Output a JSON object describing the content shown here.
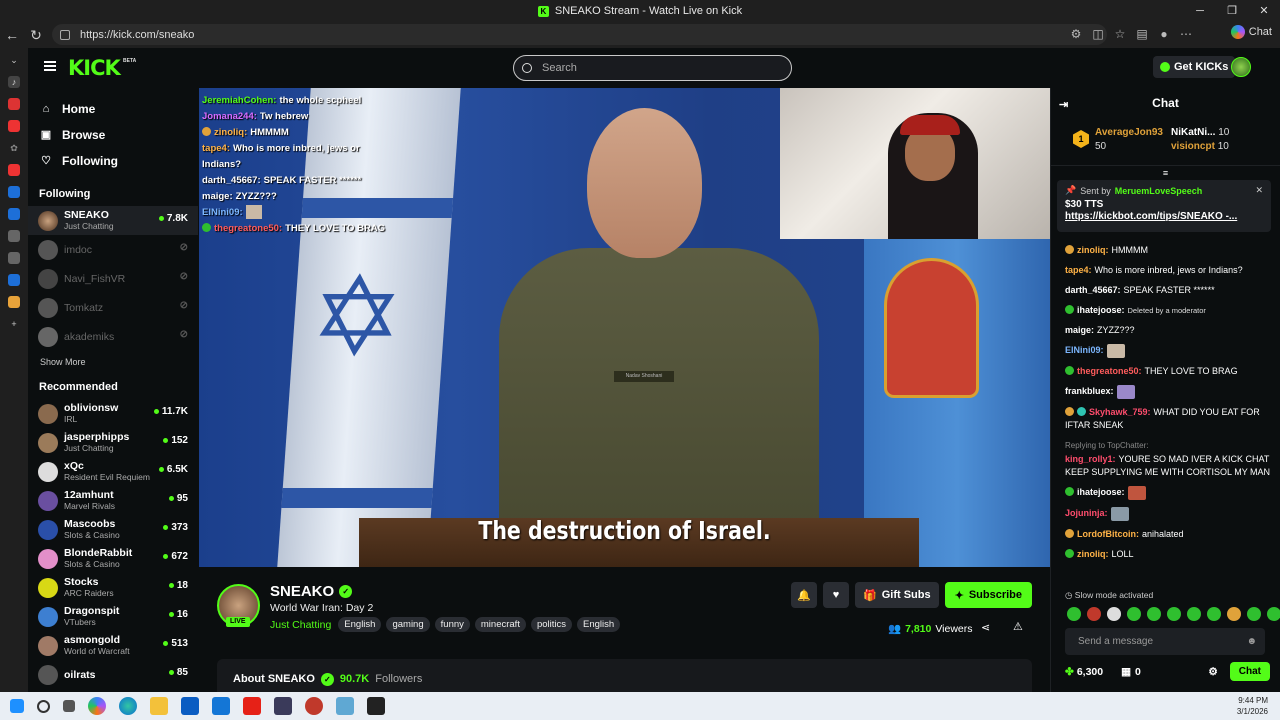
{
  "window": {
    "title": "SNEAKO Stream - Watch Live on Kick",
    "url": "https://kick.com/sneako"
  },
  "browser": {
    "copilot_label": "Chat"
  },
  "header": {
    "logo": "KICK",
    "beta": "BETA",
    "search_placeholder": "Search",
    "get_kicks": "Get KICKs"
  },
  "sidebar": {
    "nav": [
      {
        "label": "Home",
        "icon": "home-icon"
      },
      {
        "label": "Browse",
        "icon": "browse-icon"
      },
      {
        "label": "Following",
        "icon": "heart-icon"
      }
    ],
    "following_title": "Following",
    "following": [
      {
        "name": "SNEAKO",
        "category": "Just Chatting",
        "viewers": "7.8K",
        "live": true
      },
      {
        "name": "imdoc",
        "live": false
      },
      {
        "name": "Navi_FishVR",
        "live": false
      },
      {
        "name": "Tomkatz",
        "live": false
      },
      {
        "name": "akademiks",
        "live": false
      }
    ],
    "show_more": "Show More",
    "recommended_title": "Recommended",
    "recommended": [
      {
        "name": "oblivionsw",
        "category": "IRL",
        "viewers": "11.7K"
      },
      {
        "name": "jasperphipps",
        "category": "Just Chatting",
        "viewers": "152"
      },
      {
        "name": "xQc",
        "category": "Resident Evil Requiem",
        "viewers": "6.5K"
      },
      {
        "name": "12amhunt",
        "category": "Marvel Rivals",
        "viewers": "95"
      },
      {
        "name": "Mascoobs",
        "category": "Slots & Casino",
        "viewers": "373"
      },
      {
        "name": "BlondeRabbit",
        "category": "Slots & Casino",
        "viewers": "672"
      },
      {
        "name": "Stocks",
        "category": "ARC Raiders",
        "viewers": "18"
      },
      {
        "name": "Dragonspit",
        "category": "VTubers",
        "viewers": "16"
      },
      {
        "name": "asmongold",
        "category": "World of Warcraft",
        "viewers": "513"
      },
      {
        "name": "oilrats",
        "category": "",
        "viewers": "85"
      }
    ]
  },
  "video": {
    "subtitle": "The destruction of Israel.",
    "name_tag": "Nadav Shoshani",
    "overlay_chat": [
      {
        "user": "JeremiahCohen:",
        "text": "the whole scpheel",
        "color": "#53fc18"
      },
      {
        "user": "Jomana244:",
        "text": "Tw hebrew",
        "color": "#d66bff"
      },
      {
        "user": "zinoliq:",
        "text": "HMMMM",
        "color": "#ffb347"
      },
      {
        "user": "tape4:",
        "text": "Who is more inbred, jews or",
        "color": "#ffb347"
      },
      {
        "user": "",
        "text": "Indians?",
        "color": "#fff"
      },
      {
        "user": "darth_45667:",
        "text": "SPEAK FASTER ******",
        "color": "#fff"
      },
      {
        "user": "maige:",
        "text": "ZYZZ???",
        "color": "#fff"
      },
      {
        "user": "ElNini09:",
        "text": "",
        "color": "#7cb7ff"
      },
      {
        "user": "thegreatone50:",
        "text": "THEY LOVE TO BRAG",
        "color": "#ff5c5c"
      }
    ]
  },
  "stream": {
    "name": "SNEAKO",
    "live_badge": "LIVE",
    "title": "World War Iran: Day 2",
    "category": "Just Chatting",
    "tags": [
      "English",
      "gaming",
      "funny",
      "minecraft",
      "politics",
      "English"
    ],
    "gift_label": "Gift Subs",
    "subscribe_label": "Subscribe",
    "viewers": "7,810",
    "viewers_label": "Viewers",
    "about": "About SNEAKO",
    "followers": "90.7K",
    "followers_label": "Followers"
  },
  "chat": {
    "title": "Chat",
    "leaderboard": [
      {
        "name": "AverageJon93",
        "value": "50"
      },
      {
        "name": "NiKatNi...",
        "value": "10"
      },
      {
        "name": "visioncpt",
        "value": "10"
      }
    ],
    "pinned": {
      "sent_by_label": "Sent by",
      "sender": "MeruemLoveSpeech",
      "amount": "$30 TTS",
      "link": "https://kickbot.com/tips/SNEAKO -..."
    },
    "messages": [
      {
        "user": "zinoliq:",
        "text": "HMMMM",
        "color": "#ffb347"
      },
      {
        "user": "tape4:",
        "text": "Who is more inbred, jews or Indians?",
        "color": "#ffb347"
      },
      {
        "user": "darth_45667:",
        "text": "SPEAK FASTER ******",
        "color": "#fff"
      },
      {
        "user": "ihatejoose:",
        "text": "Deleted by a moderator",
        "color": "#fff",
        "deleted": true
      },
      {
        "user": "maige:",
        "text": "ZYZZ???",
        "color": "#fff"
      },
      {
        "user": "ElNini09:",
        "text": "",
        "color": "#7cb7ff",
        "image": true
      },
      {
        "user": "thegreatone50:",
        "text": "THEY LOVE TO BRAG",
        "color": "#ff5c5c"
      },
      {
        "user": "frankbluex:",
        "text": "",
        "color": "#fff",
        "image": true
      },
      {
        "user": "Skyhawk_759:",
        "text": "WHAT DID YOU EAT FOR IFTAR SNEAK",
        "color": "#ff4d6d"
      },
      {
        "user": "king_rolly1:",
        "text": "YOURE SO MAD IVER A KICK CHAT KEEP SUPPLYING ME WITH CORTISOL MY MAN",
        "color": "#ff4d6d",
        "reply": "Replying to TopChatter:"
      },
      {
        "user": "ihatejoose:",
        "text": "",
        "color": "#fff",
        "image": true
      },
      {
        "user": "Jojuninja:",
        "text": "",
        "color": "#ff4d6d",
        "image": true
      },
      {
        "user": "LordofBitcoin:",
        "text": "anihalated",
        "color": "#ffb347"
      },
      {
        "user": "zinoliq:",
        "text": "LOLL",
        "color": "#ffb347"
      }
    ],
    "slow_mode": "Slow mode activated",
    "input_placeholder": "Send a message",
    "points": "6,300",
    "chest": "0",
    "send_label": "Chat"
  },
  "taskbar": {
    "time": "9:44 PM",
    "date": "3/1/2026"
  }
}
